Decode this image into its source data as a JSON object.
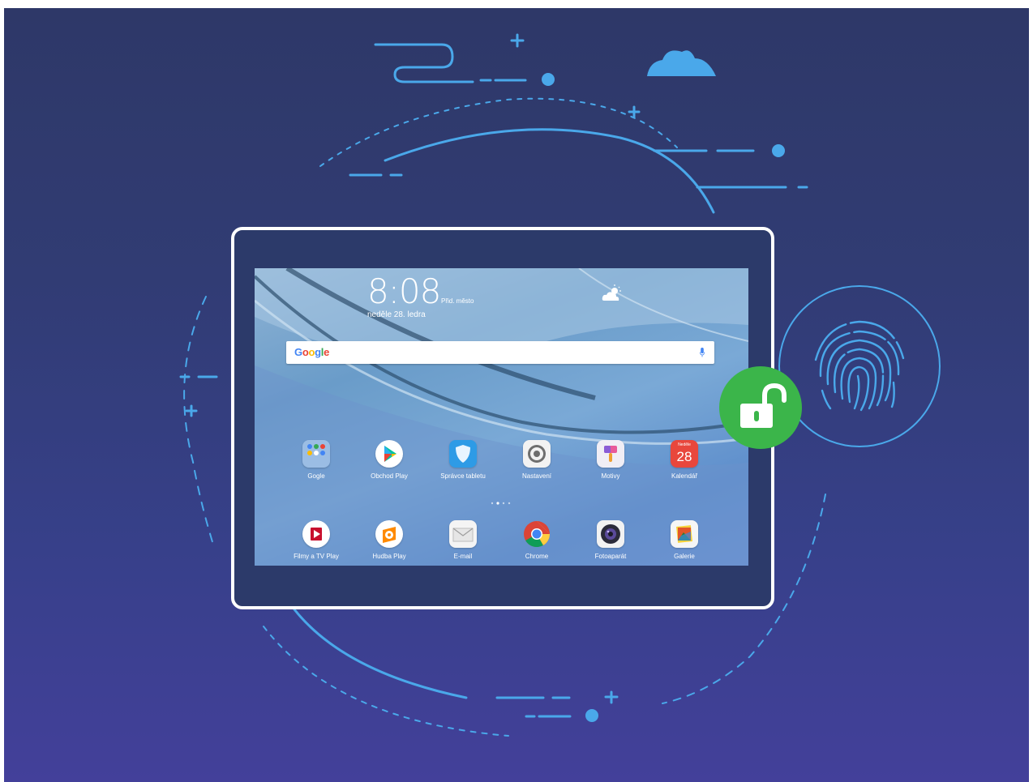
{
  "lock_screen": {
    "time": "8:08",
    "location": "Přid. město",
    "date": "neděle 28. ledra",
    "weather_icon": "partly-sunny-icon"
  },
  "search_bar": {
    "logo_text": "Google",
    "mic_icon": "microphone-icon"
  },
  "apps_row1": [
    {
      "label": "Gogle",
      "icon": "folder-icon"
    },
    {
      "label": "Obchod Play",
      "icon": "play-store-icon"
    },
    {
      "label": "Správce tabletu",
      "icon": "shield-icon"
    },
    {
      "label": "Nastavení",
      "icon": "settings-gear-icon"
    },
    {
      "label": "Motivy",
      "icon": "brush-icon"
    },
    {
      "label": "Kalendář",
      "icon": "calendar-icon",
      "calendar_day": "28",
      "calendar_weekday": "Neděle"
    }
  ],
  "page_indicator": {
    "pages": 4,
    "current": 2
  },
  "apps_row2": [
    {
      "label": "Filmy a TV Play",
      "icon": "play-movies-icon"
    },
    {
      "label": "Hudba Play",
      "icon": "play-music-icon"
    },
    {
      "label": "E-mail",
      "icon": "envelope-icon"
    },
    {
      "label": "Chrome",
      "icon": "chrome-icon"
    },
    {
      "label": "Fotoaparát",
      "icon": "camera-icon"
    },
    {
      "label": "Galerie",
      "icon": "gallery-icon"
    }
  ],
  "fingerprint": {
    "icon": "fingerprint-icon"
  },
  "unlock": {
    "icon": "unlocked-padlock-icon",
    "color": "#3bb54a"
  },
  "colors": {
    "accent_line": "#4aa8ea",
    "background_top": "#2e3868",
    "background_bottom": "#43409a"
  }
}
